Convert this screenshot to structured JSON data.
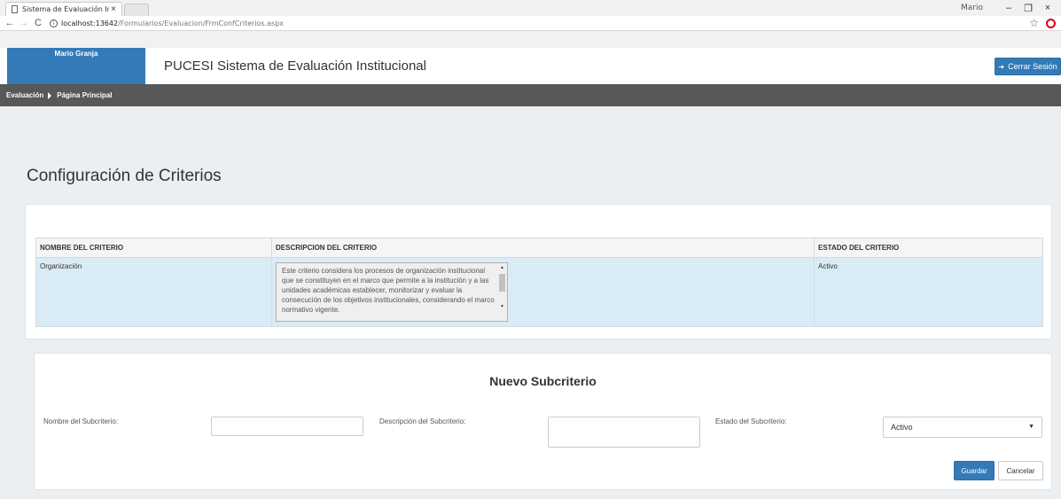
{
  "browser": {
    "tab_title": "Sistema de Evaluación In",
    "tab_close": "×",
    "user_profile": "Mario",
    "window_minimize": "–",
    "window_restore": "❐",
    "window_close": "×",
    "url_host": "localhost:13642",
    "url_path": "/Formularios/Evaluacion/FrmConfCriterios.aspx"
  },
  "header": {
    "user_name": "Mario Granja",
    "brand": "PUCESI Sistema de Evaluación Institucional",
    "logout_label": "Cerrar Sesión"
  },
  "breadcrumb": {
    "item1": "Evaluación",
    "item2": "Página Principal"
  },
  "page": {
    "title": "Configuración de Criterios"
  },
  "criteria_table": {
    "headers": [
      "NOMBRE DEL CRITERIO",
      "DESCRIPCION DEL CRITERIO",
      "ESTADO DEL CRITERIO"
    ],
    "rows": [
      {
        "name": "Organización",
        "description": "Este criterio considera los procesos  de organización institucional que se constituyen en el marco que permite a la institución y a las unidades académicas establecer, monitorizar y evaluar la consecución de los objetivos institucionales, considerando el marco normativo vigente.",
        "status": "Activo"
      }
    ]
  },
  "new_subcriterion": {
    "title": "Nuevo Subcriterio",
    "name_label": "Nombre del Subcriterio:",
    "name_value": "",
    "description_label": "Descripción del Subcriterio:",
    "description_value": "",
    "status_label": "Estado del Subcriterio:",
    "status_selected": "Activo",
    "save_label": "Guardar",
    "cancel_label": "Cancelar"
  },
  "colors": {
    "primary": "#337ab7",
    "navbar": "#585858",
    "selected_row": "#d9ebf5"
  }
}
